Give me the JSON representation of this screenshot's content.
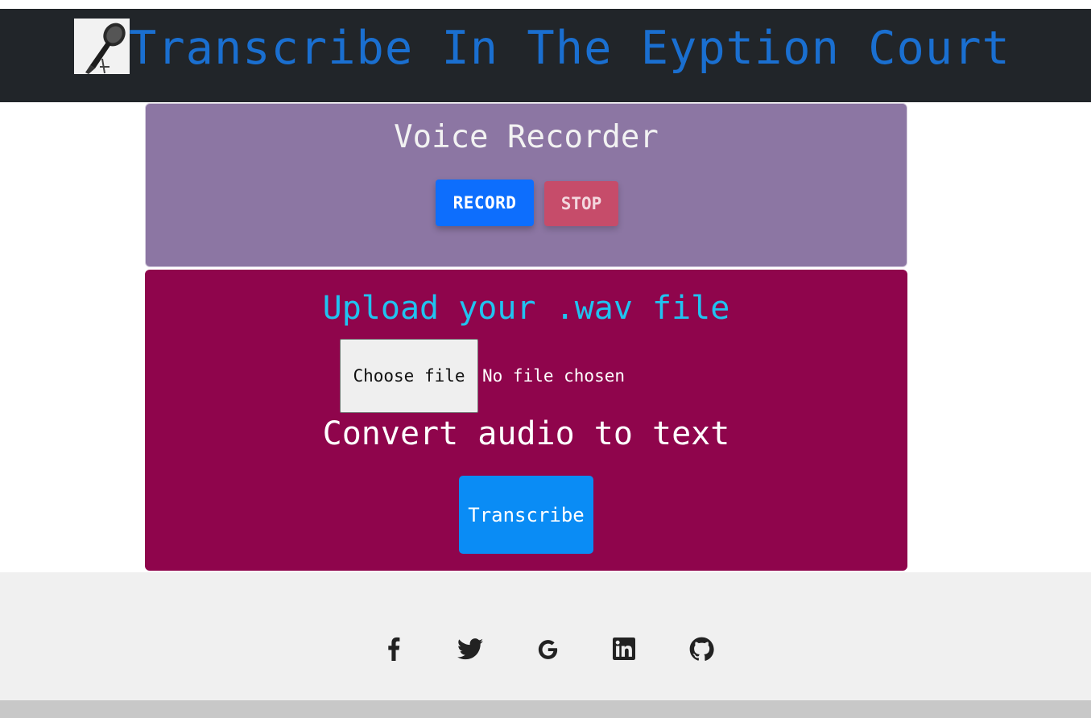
{
  "header": {
    "title": "Transcribe In The Eyption Court",
    "logo_icon": "microphone-icon"
  },
  "recorder": {
    "title": "Voice Recorder",
    "record_label": "RECORD",
    "stop_label": "STOP"
  },
  "upload": {
    "title": "Upload your .wav file",
    "choose_file_label": "Choose file",
    "file_status": "No file chosen",
    "convert_title": "Convert audio to text",
    "transcribe_label": "Transcribe"
  },
  "footer": {
    "social_icons": [
      "facebook-icon",
      "twitter-icon",
      "google-icon",
      "linkedin-icon",
      "github-icon"
    ]
  },
  "colors": {
    "navbar": "#212529",
    "brand": "#1a6fd0",
    "recorder_bg": "#8c76a3",
    "upload_bg": "#8f054c",
    "upload_title": "#20c3f0",
    "record_button": "#0d6efd",
    "stop_button": "#c64c6a",
    "transcribe_button": "#0a8cf5"
  }
}
